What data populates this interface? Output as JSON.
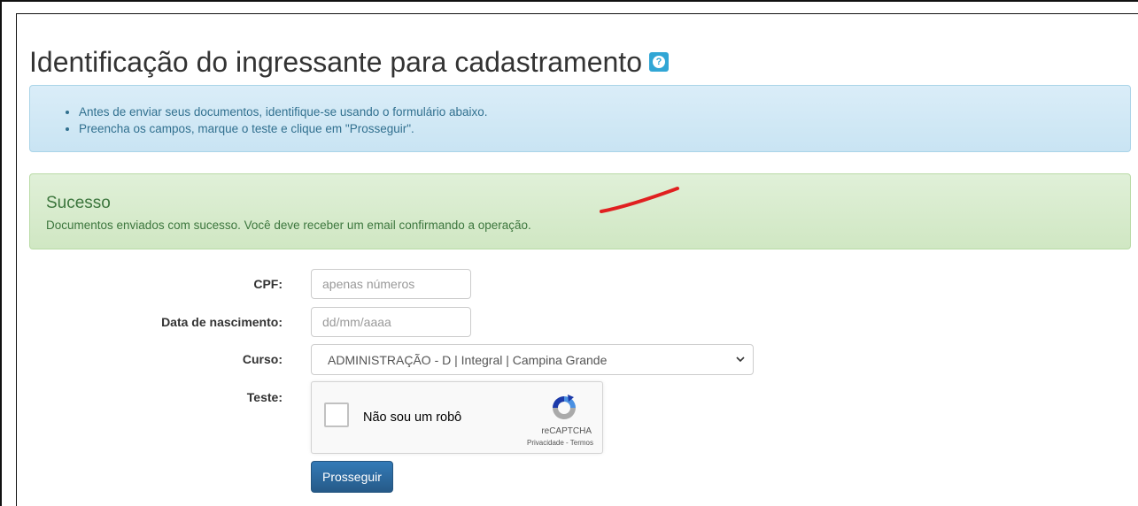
{
  "header": {
    "title": "Identificação do ingressante para cadastramento",
    "help_icon": "help-question-icon"
  },
  "info": {
    "items": [
      "Antes de enviar seus documentos, identifique-se usando o formulário abaixo.",
      "Preencha os campos, marque o teste e clique em \"Prosseguir\"."
    ]
  },
  "alert": {
    "title": "Sucesso",
    "message": "Documentos enviados com sucesso. Você deve receber um email confirmando a operação."
  },
  "form": {
    "cpf_label": "CPF:",
    "cpf_placeholder": "apenas números",
    "birth_label": "Data de nascimento:",
    "birth_placeholder": "dd/mm/aaaa",
    "course_label": "Curso:",
    "course_value": "ADMINISTRAÇÃO - D | Integral | Campina Grande",
    "test_label": "Teste:",
    "captcha_label": "Não sou um robô",
    "captcha_brand": "reCAPTCHA",
    "captcha_links": "Privacidade - Termos",
    "submit_label": "Prosseguir"
  },
  "colors": {
    "primary": "#337ab7",
    "info_bg": "#d9edf7",
    "success_bg": "#dff0d8",
    "success_text": "#3c763d",
    "annotation": "#e02020"
  }
}
